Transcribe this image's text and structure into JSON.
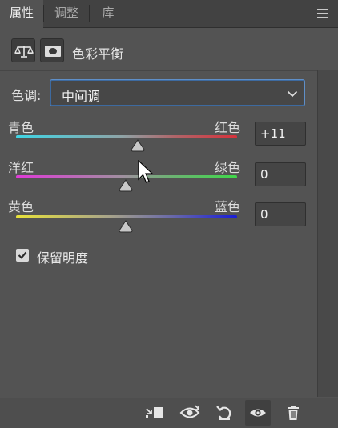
{
  "tabs": [
    {
      "label": "属性",
      "active": true
    },
    {
      "label": "调整",
      "active": false
    },
    {
      "label": "库",
      "active": false
    }
  ],
  "panel_menu_icon": "hamburger-menu-icon",
  "header": {
    "icons": [
      "balance-scale-icon",
      "layer-mask-icon"
    ],
    "title": "色彩平衡"
  },
  "tone": {
    "label": "色调:",
    "selected": "中间调"
  },
  "sliders": [
    {
      "left_label": "青色",
      "right_label": "红色",
      "value": "+11",
      "gradient": [
        "#3fd6e6",
        "#d8323c"
      ]
    },
    {
      "left_label": "洋红",
      "right_label": "绿色",
      "value": "0",
      "gradient": [
        "#e03ad8",
        "#3fd84a"
      ]
    },
    {
      "left_label": "黄色",
      "right_label": "蓝色",
      "value": "0",
      "gradient": [
        "#e8e23a",
        "#1a1ed8"
      ]
    }
  ],
  "preserve_luminosity": {
    "label": "保留明度",
    "checked": true
  },
  "toolbar": {
    "buttons": [
      "clip-to-layer-icon",
      "view-previous-state-icon",
      "reset-icon",
      "visibility-eye-icon",
      "trash-icon"
    ],
    "active": "visibility-eye-icon"
  },
  "colors": {
    "panel_bg": "#535353",
    "tabbar_bg": "#424242",
    "select_border": "#5f8fc8"
  }
}
